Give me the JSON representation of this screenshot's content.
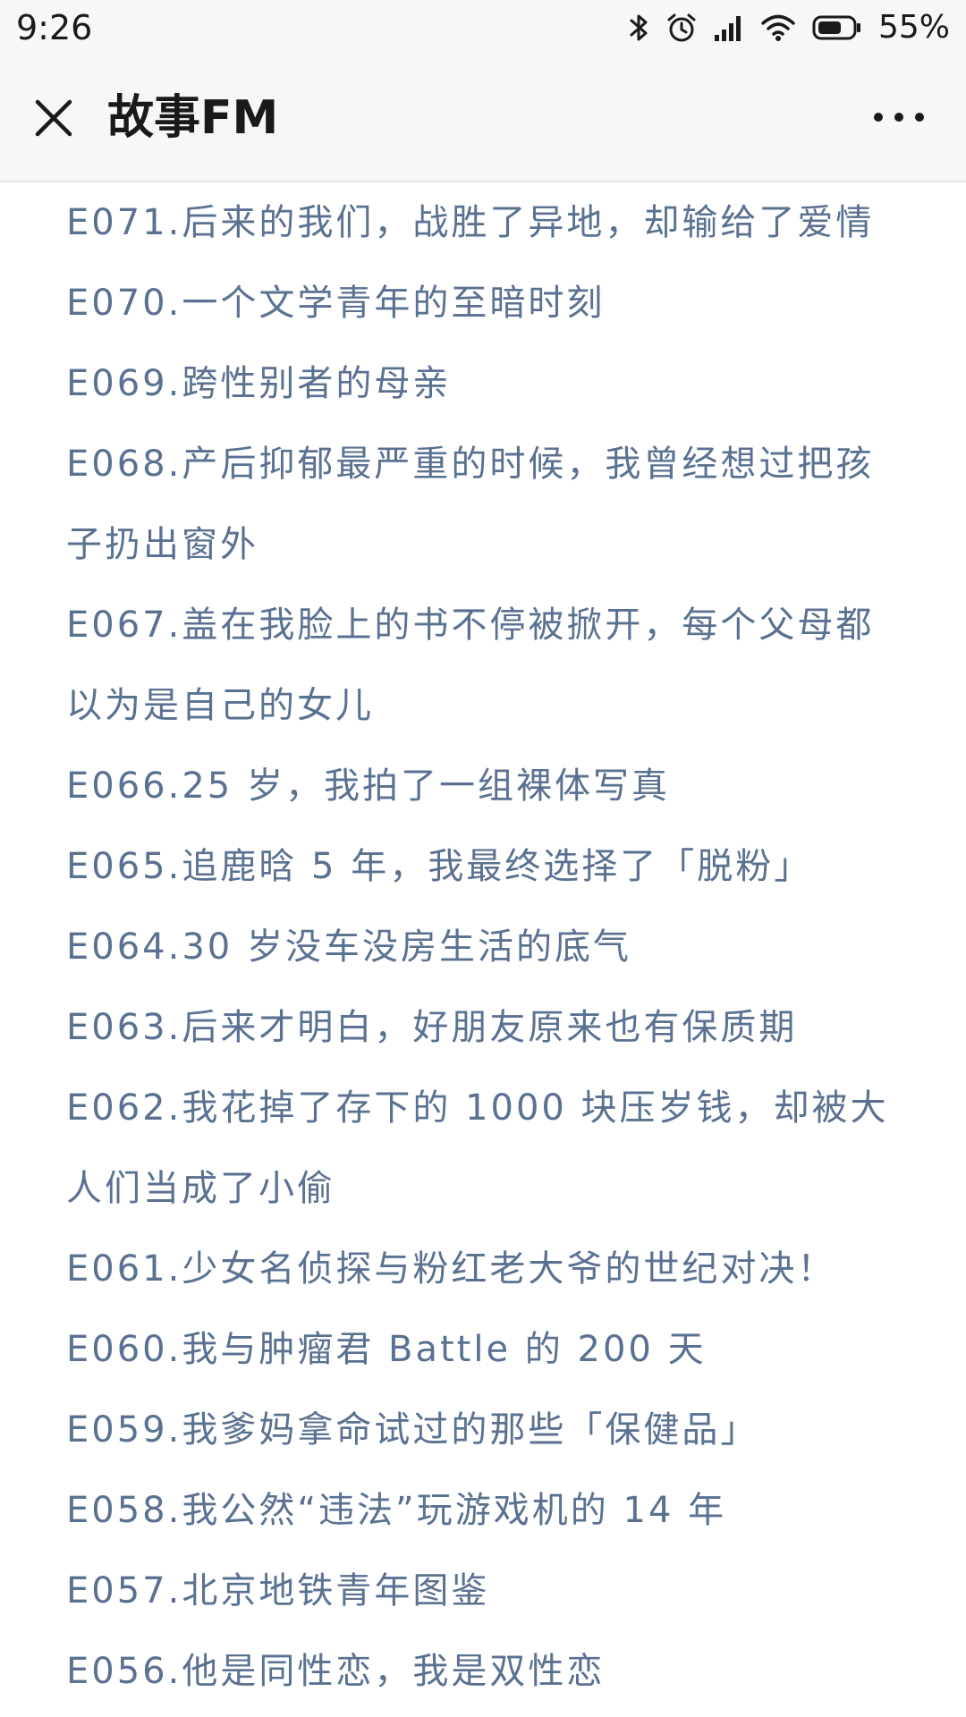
{
  "status_bar": {
    "time": "9:26",
    "battery": "55%",
    "icons": [
      "bluetooth-icon",
      "alarm-icon",
      "signal-icon",
      "wifi-icon",
      "battery-icon"
    ]
  },
  "nav": {
    "title": "故事FM",
    "close_icon": "close-icon",
    "more_icon": "more-icon"
  },
  "episodes": [
    "E071.后来的我们，战胜了异地，却输给了爱情",
    "E070.一个文学青年的至暗时刻",
    "E069.跨性别者的母亲",
    "E068.产后抑郁最严重的时候，我曾经想过把孩子扔出窗外",
    "E067.盖在我脸上的书不停被掀开，每个父母都以为是自己的女儿",
    "E066.25 岁，我拍了一组裸体写真",
    "E065.追鹿晗 5 年，我最终选择了「脱粉」",
    "E064.30 岁没车没房生活的底气",
    "E063.后来才明白，好朋友原来也有保质期",
    "E062.我花掉了存下的 1000 块压岁钱，却被大人们当成了小偷",
    "E061.少女名侦探与粉红老大爷的世纪对决！",
    "E060.我与肿瘤君 Battle 的 200 天",
    "E059.我爹妈拿命试过的那些「保健品」",
    "E058.我公然“违法”玩游戏机的 14 年",
    "E057.北京地铁青年图鉴",
    "E056.他是同性恋，我是双性恋"
  ],
  "colors": {
    "link": "#5a7191",
    "header_bg": "#f7f7f7",
    "text": "#1a1a1a"
  }
}
